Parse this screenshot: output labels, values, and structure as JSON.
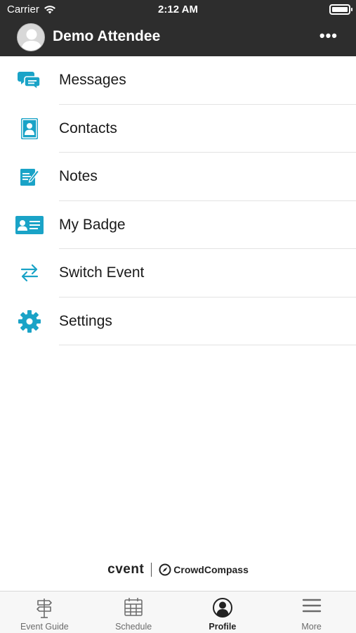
{
  "status_bar": {
    "carrier": "Carrier",
    "time": "2:12 AM"
  },
  "header": {
    "user_name": "Demo Attendee",
    "more_label": "•••"
  },
  "menu": {
    "items": [
      {
        "label": "Messages",
        "icon": "chat-bubbles-icon"
      },
      {
        "label": "Contacts",
        "icon": "address-book-icon"
      },
      {
        "label": "Notes",
        "icon": "notepad-icon"
      },
      {
        "label": "My Badge",
        "icon": "id-card-icon"
      },
      {
        "label": "Switch Event",
        "icon": "swap-arrows-icon"
      },
      {
        "label": "Settings",
        "icon": "gear-icon"
      }
    ]
  },
  "branding": {
    "left": "cvent",
    "right": "CrowdCompass"
  },
  "tab_bar": {
    "tabs": [
      {
        "label": "Event Guide",
        "icon": "signpost-icon"
      },
      {
        "label": "Schedule",
        "icon": "calendar-icon"
      },
      {
        "label": "Profile",
        "icon": "profile-icon",
        "active": true
      },
      {
        "label": "More",
        "icon": "hamburger-icon"
      }
    ]
  },
  "colors": {
    "accent": "#1aa3c7",
    "header_bg": "#2d2d2d",
    "divider": "#e3e3e3"
  }
}
